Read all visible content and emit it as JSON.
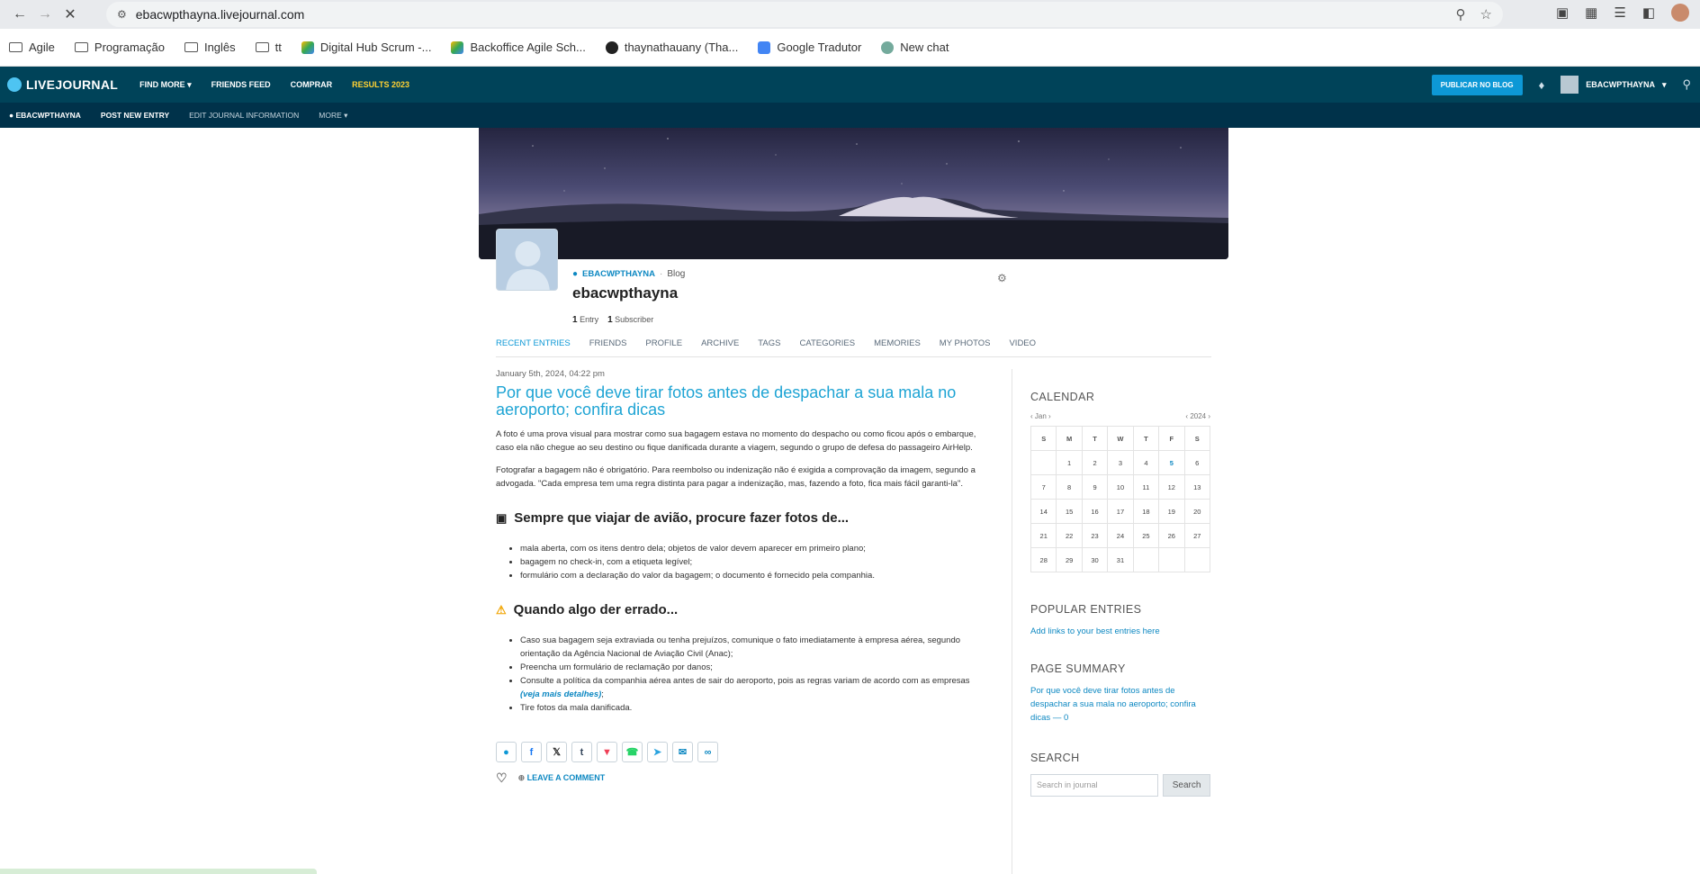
{
  "browser": {
    "url": "ebacwpthayna.livejournal.com",
    "bookmarks": [
      "Agile",
      "Programação",
      "Inglês",
      "tt",
      "Digital Hub Scrum -...",
      "Backoffice Agile Sch...",
      "thaynathauany (Tha...",
      "Google Tradutor",
      "New chat"
    ]
  },
  "lj": {
    "logo": "LIVEJOURNAL",
    "menu": [
      "FIND MORE",
      "FRIENDS FEED",
      "COMPRAR",
      "RESULTS 2023"
    ],
    "publish": "PUBLICAR NO BLOG",
    "user": "EBACWPTHAYNA",
    "sub": [
      "EBACWPTHAYNA",
      "POST NEW ENTRY",
      "EDIT JOURNAL INFORMATION",
      "MORE"
    ]
  },
  "journal": {
    "username": "EBACWPTHAYNA",
    "type": "Blog",
    "title": "ebacwpthayna",
    "entries_count": "1",
    "entries_label": "Entry",
    "subs_count": "1",
    "subs_label": "Subscriber"
  },
  "tabs": [
    "RECENT ENTRIES",
    "FRIENDS",
    "PROFILE",
    "ARCHIVE",
    "TAGS",
    "CATEGORIES",
    "MEMORIES",
    "MY PHOTOS",
    "VIDEO"
  ],
  "post": {
    "date": "January 5th, 2024, 04:22 pm",
    "title": "Por que você deve tirar fotos antes de despachar a sua mala no aeroporto; confira dicas",
    "p1": "A foto é uma prova visual para mostrar como sua bagagem estava no momento do despacho ou como ficou após o embarque, caso ela não chegue ao seu destino ou fique danificada durante a viagem, segundo o grupo de defesa do passageiro AirHelp.",
    "p2": "Fotografar a bagagem não é obrigatório. Para reembolso ou indenização não é exigida a comprovação da imagem, segundo a advogada. \"Cada empresa tem uma regra distinta para pagar a indenização, mas, fazendo a foto, fica mais fácil garanti-la\".",
    "h1": "Sempre que viajar de avião, procure fazer fotos de...",
    "list1": [
      "mala aberta, com os itens dentro dela; objetos de valor devem aparecer em primeiro plano;",
      "bagagem no check-in, com a etiqueta legível;",
      "formulário com a declaração do valor da bagagem; o documento é fornecido pela companhia."
    ],
    "h2": "Quando algo der errado...",
    "list2_0": "Caso sua bagagem seja extraviada ou tenha prejuízos, comunique o fato imediatamente à empresa aérea, segundo orientação da Agência Nacional de Aviação Civil (Anac);",
    "list2_1": "Preencha um formulário de reclamação por danos;",
    "list2_2a": "Consulte a política da companhia aérea antes de sair do aeroporto, pois as regras variam de acordo com as empresas",
    "list2_2link": "(veja mais detalhes)",
    "list2_3": "Tire fotos da mala danificada.",
    "comment": "LEAVE A COMMENT"
  },
  "sidebar": {
    "calendar_title": "CALENDAR",
    "month": "Jan",
    "year": "2024",
    "days": [
      "S",
      "M",
      "T",
      "W",
      "T",
      "F",
      "S"
    ],
    "popular_title": "POPULAR ENTRIES",
    "popular_link": "Add links to your best entries here",
    "summary_title": "PAGE SUMMARY",
    "summary_link": "Por que você deve tirar fotos antes de despachar a sua mala no aeroporto; confira dicas — 0",
    "search_title": "SEARCH",
    "search_placeholder": "Search in journal",
    "search_btn": "Search"
  }
}
